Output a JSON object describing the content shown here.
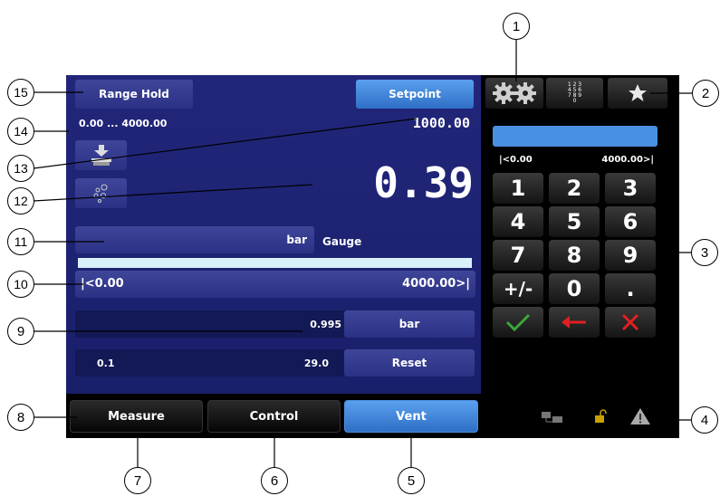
{
  "header": {
    "range_hold": "Range Hold",
    "setpoint": "Setpoint"
  },
  "range_text": "0.00 ... 4000.00",
  "setpoint_value": "1000.00",
  "reading": "0.39",
  "unit": {
    "unit": "bar",
    "mode": "Gauge"
  },
  "range_bar": {
    "min": "|<0.00",
    "max": "4000.00>|"
  },
  "row9": {
    "value": "0.995",
    "button": "bar"
  },
  "row10": {
    "left": "0.1",
    "right": "29.0",
    "button": "Reset"
  },
  "tabs": {
    "measure": "Measure",
    "control": "Control",
    "vent": "Vent"
  },
  "keypad": {
    "range_min": "|<0.00",
    "range_max": "4000.00>|",
    "keys": [
      "1",
      "2",
      "3",
      "4",
      "5",
      "6",
      "7",
      "8",
      "9",
      "+/-",
      "0",
      "."
    ]
  },
  "numpad_icon_lines": [
    "1 2 3",
    "4 5 6",
    "7 8 9",
    "0"
  ],
  "callouts": [
    "1",
    "2",
    "3",
    "4",
    "5",
    "6",
    "7",
    "8",
    "9",
    "10",
    "11",
    "12",
    "13",
    "14",
    "15"
  ],
  "colors": {
    "screen_blue": "#1f2470",
    "accent_blue": "#3a7fd6",
    "confirm": "#3aa83a",
    "cancel": "#e02020"
  }
}
